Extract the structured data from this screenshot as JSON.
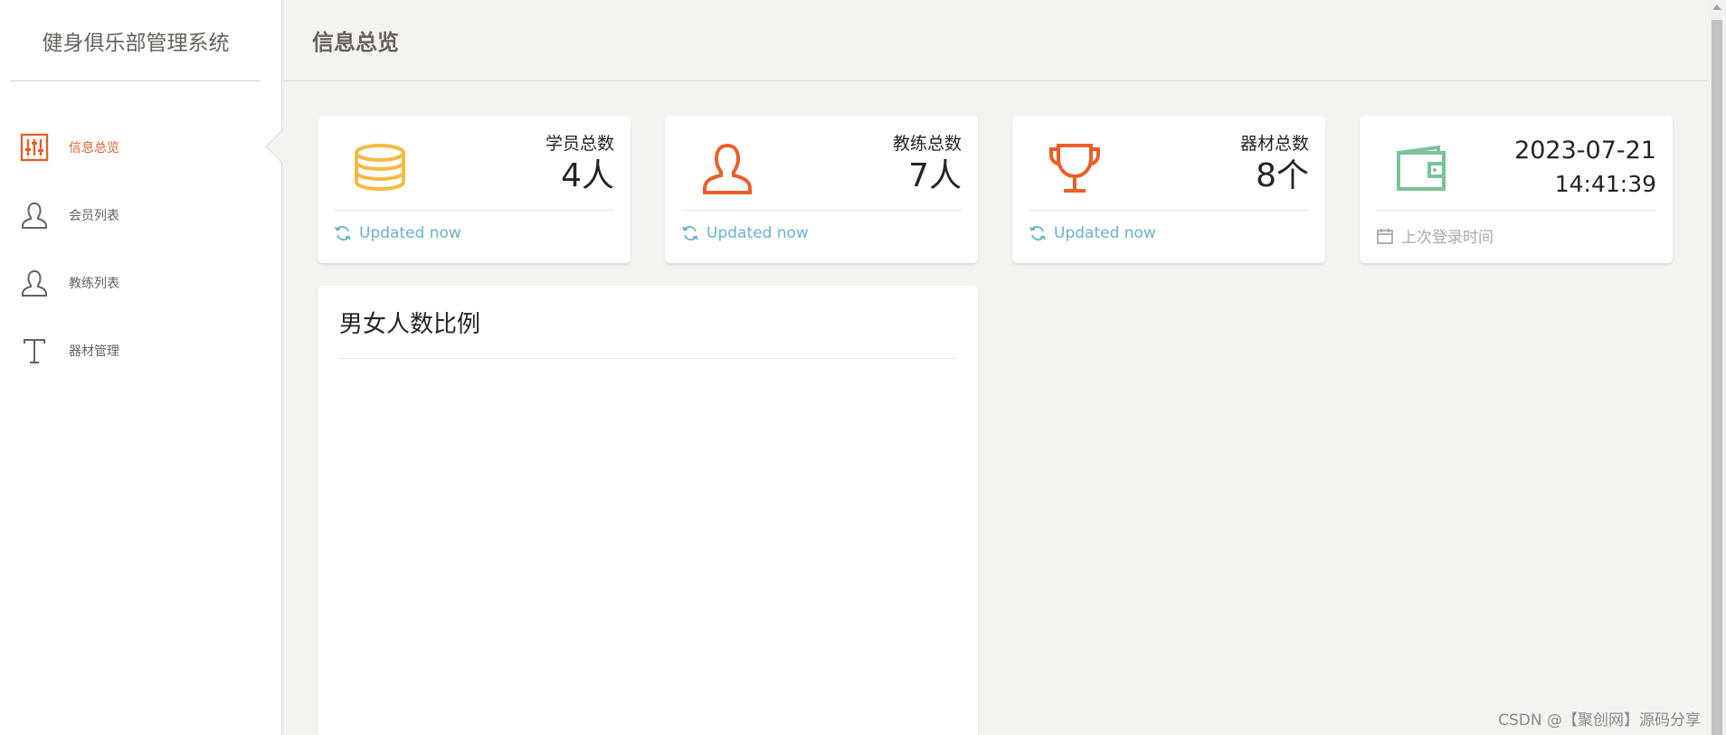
{
  "app": {
    "title": "健身俱乐部管理系统"
  },
  "sidebar": {
    "items": [
      {
        "label": "信息总览",
        "icon": "sliders-icon",
        "active": true
      },
      {
        "label": "会员列表",
        "icon": "user-icon",
        "active": false
      },
      {
        "label": "教练列表",
        "icon": "user-icon",
        "active": false
      },
      {
        "label": "器材管理",
        "icon": "text-icon",
        "active": false
      }
    ]
  },
  "header": {
    "title": "信息总览"
  },
  "stats": [
    {
      "label": "学员总数",
      "value": "4人",
      "footer": "Updated now",
      "icon": "coins-icon",
      "icon_color": "#f3bb45",
      "footer_icon": "refresh-icon"
    },
    {
      "label": "教练总数",
      "value": "7人",
      "footer": "Updated now",
      "icon": "user-icon",
      "icon_color": "#eb5e28",
      "footer_icon": "refresh-icon"
    },
    {
      "label": "器材总数",
      "value": "8个",
      "footer": "Updated now",
      "icon": "cup-icon",
      "icon_color": "#eb5e28",
      "footer_icon": "refresh-icon"
    },
    {
      "date": "2023-07-21",
      "time": "14:41:39",
      "footer": "上次登录时间",
      "icon": "wallet-icon",
      "icon_color": "#7ac29a",
      "footer_icon": "calendar-icon"
    }
  ],
  "chart_card": {
    "title": "男女人数比例"
  },
  "watermark": "CSDN @【聚创网】源码分享",
  "colors": {
    "accent": "#e0632c",
    "info": "#68b3c8",
    "warning": "#f3bb45",
    "danger": "#eb5e28",
    "success": "#7ac29a"
  }
}
